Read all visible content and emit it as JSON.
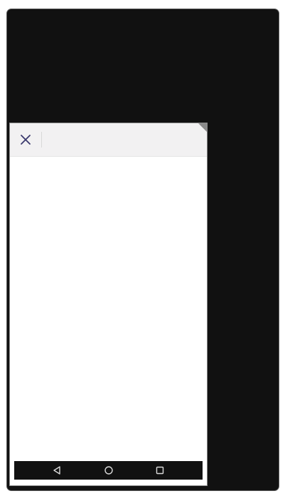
{
  "device": {
    "frame_color": "#111111",
    "window_background": "#ffffff",
    "toolbar_background": "#f2f1f2",
    "accent_color": "#3b3a6e"
  },
  "toolbar": {
    "close_icon": "close-icon"
  },
  "nav_bar": {
    "background": "#111111",
    "buttons": [
      "back-icon",
      "home-icon",
      "recents-icon"
    ]
  }
}
